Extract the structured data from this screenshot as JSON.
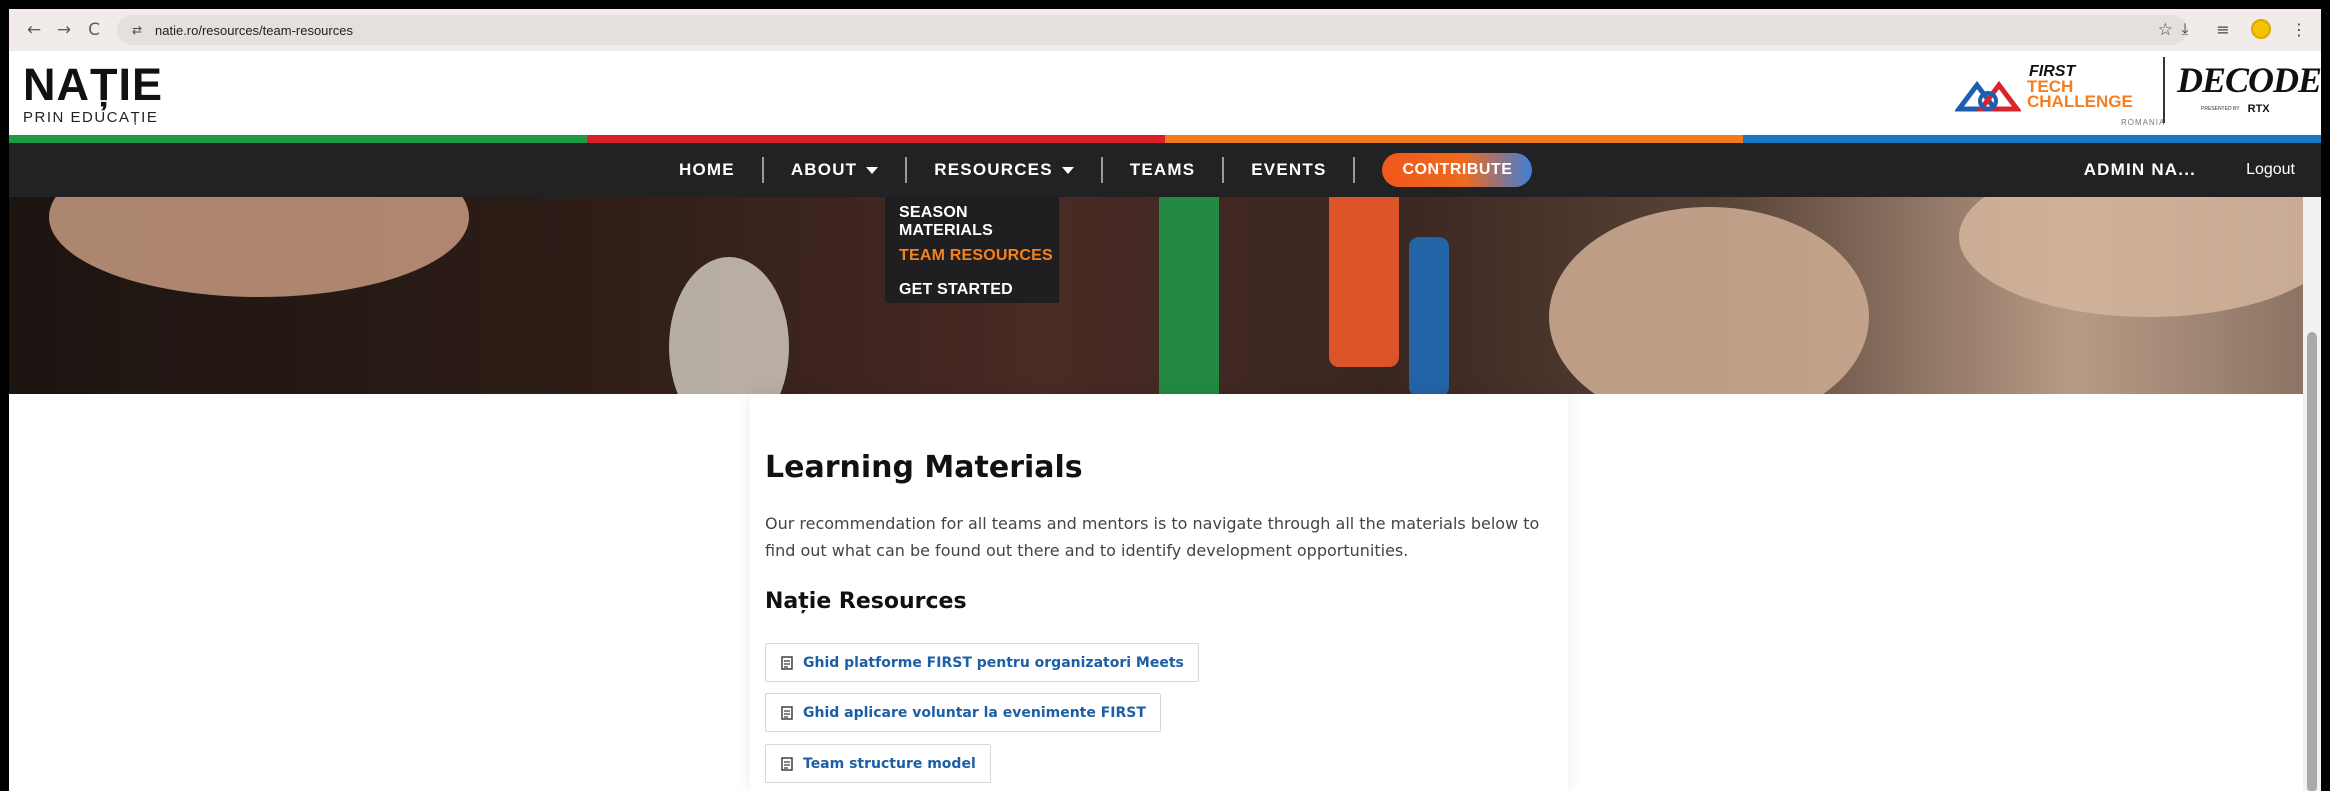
{
  "browser": {
    "url": "natie.ro/resources/team-resources",
    "back_glyph": "←",
    "forward_glyph": "→",
    "reload_glyph": "C",
    "tune_glyph": "⇄",
    "star_glyph": "☆",
    "download_glyph": "⤓",
    "media_glyph": "≡",
    "menu_glyph": "⋮"
  },
  "logo": {
    "main": "NAȚIE",
    "sub": "PRIN EDUCAȚIE"
  },
  "partner_logos": {
    "first_label": "FIRST",
    "ftc_lines": [
      "TECH",
      "CHALLENGE"
    ],
    "ftc_country": "ROMANIA",
    "season_logo": "DECODE",
    "presented_by": "PRESENTED BY",
    "sponsor": "RTX"
  },
  "stripe_colors": [
    "#1d9b46",
    "#d81f26",
    "#f07a1a",
    "#1a78c2"
  ],
  "nav": {
    "home": "HOME",
    "about": "ABOUT",
    "resources": "RESOURCES",
    "teams": "TEAMS",
    "events": "EVENTS",
    "contribute": "CONTRIBUTE",
    "admin": "ADMIN NA...",
    "logout": "Logout"
  },
  "dropdown": {
    "items": [
      {
        "label": "SEASON MATERIALS"
      },
      {
        "label": "TEAM RESOURCES"
      },
      {
        "label": "GET STARTED"
      }
    ],
    "active_color": "#f5821f"
  },
  "content": {
    "title": "Learning Materials",
    "intro": "Our recommendation for all teams and mentors is to navigate through all the materials below to find out what can be found out there and to identify development opportunities.",
    "section_title": "Nație Resources",
    "links": [
      {
        "label": "Ghid platforme FIRST pentru organizatori Meets",
        "icon": "document-icon"
      },
      {
        "label": "Ghid aplicare voluntar la evenimente FIRST",
        "icon": "document-icon"
      },
      {
        "label": "Team structure model",
        "icon": "document-icon"
      }
    ],
    "link_color": "#1c5fa4"
  }
}
